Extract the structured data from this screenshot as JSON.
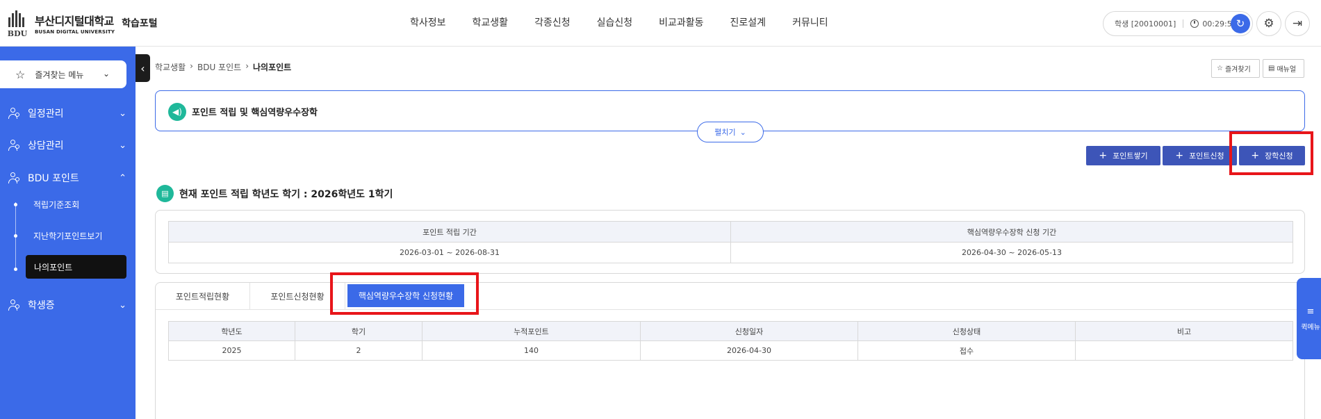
{
  "header": {
    "logo_mark": "BDU",
    "logo_korean": "부산디지털대학교",
    "logo_english": "BUSAN DIGITAL UNIVERSITY",
    "portal_title": "학습포털",
    "nav": [
      "학사정보",
      "학교생활",
      "각종신청",
      "실습신청",
      "비교과활동",
      "진로설계",
      "커뮤니티"
    ],
    "user_label": "학생 [20010001]",
    "timer": "00:29:50"
  },
  "sidebar": {
    "favorites_label": "즐겨찾는 메뉴",
    "items": [
      {
        "label": "일정관리",
        "chevron": "⌄"
      },
      {
        "label": "상담관리",
        "chevron": "⌄"
      },
      {
        "label": "BDU 포인트",
        "chevron": "⌃"
      },
      {
        "label": "학생증",
        "chevron": "⌄"
      }
    ],
    "sub_items": [
      "적립기준조회",
      "지난학기포인트보기",
      "나의포인트"
    ]
  },
  "breadcrumb": {
    "items": [
      "학교생활",
      "BDU 포인트"
    ],
    "current": "나의포인트"
  },
  "toolbar": {
    "favorite_label": "즐겨찾기",
    "manual_label": "매뉴얼"
  },
  "notice": {
    "title": "포인트 적립 및 핵심역량우수장학",
    "expand_label": "펼치기"
  },
  "actions": {
    "accumulate_label": "포인트쌓기",
    "apply_point_label": "포인트신청",
    "scholarship_label": "장학신청"
  },
  "section": {
    "title": "현재 포인트 적립 학년도 학기 : 2026학년도 1학기"
  },
  "periods": {
    "headers": [
      "포인트 적립 기간",
      "핵심역량우수장학 신청 기간"
    ],
    "values": [
      "2026-03-01 ~ 2026-08-31",
      "2026-04-30 ~ 2026-05-13"
    ]
  },
  "tabs": [
    "포인트적립현황",
    "포인트신청현황",
    "핵심역량우수장학 신청현황"
  ],
  "applications": {
    "headers": [
      "학년도",
      "학기",
      "누적포인트",
      "신청일자",
      "신청상태",
      "비고"
    ],
    "rows": [
      [
        "2025",
        "2",
        "140",
        "2026-04-30",
        "접수",
        ""
      ]
    ]
  },
  "quick_menu": {
    "label": "퀵메뉴"
  },
  "colors": {
    "primary": "#3b6ae8",
    "action_button": "#3d55b8",
    "highlight_box": "#e8151a",
    "teal_icon": "#1fb89a"
  }
}
